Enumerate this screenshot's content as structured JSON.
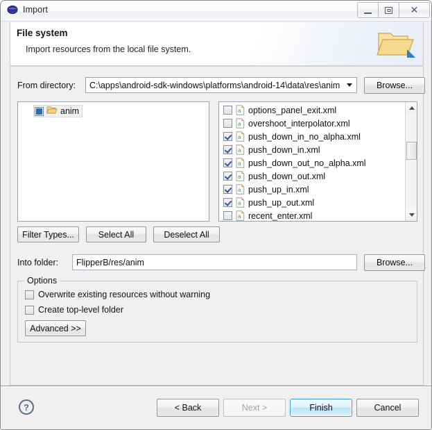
{
  "window": {
    "title": "Import",
    "app_icon": "eclipse-sphere-icon",
    "controls": {
      "minimize": "minimize-icon",
      "maximize": "maximize-icon",
      "close": "close-icon"
    }
  },
  "header": {
    "title": "File system",
    "description": "Import resources from the local file system.",
    "icon": "open-folder-icon"
  },
  "from_directory": {
    "label": "From directory:",
    "value": "C:\\apps\\android-sdk-windows\\platforms\\android-14\\data\\res\\anim",
    "placeholder": "",
    "browse_label": "Browse..."
  },
  "tree_pane": {
    "items": [
      {
        "label": "anim",
        "icon": "folder-icon",
        "checkbox": "grayed",
        "selected": true
      }
    ]
  },
  "file_pane": {
    "files": [
      {
        "name": "options_panel_exit.xml",
        "checked": false,
        "icon": "android-xml-icon"
      },
      {
        "name": "overshoot_interpolator.xml",
        "checked": false,
        "icon": "android-xml-icon"
      },
      {
        "name": "push_down_in_no_alpha.xml",
        "checked": true,
        "icon": "android-xml-icon"
      },
      {
        "name": "push_down_in.xml",
        "checked": true,
        "icon": "android-xml-icon"
      },
      {
        "name": "push_down_out_no_alpha.xml",
        "checked": true,
        "icon": "android-xml-icon"
      },
      {
        "name": "push_down_out.xml",
        "checked": true,
        "icon": "android-xml-icon"
      },
      {
        "name": "push_up_in.xml",
        "checked": true,
        "icon": "android-xml-icon"
      },
      {
        "name": "push_up_out.xml",
        "checked": true,
        "icon": "android-xml-icon"
      },
      {
        "name": "recent_enter.xml",
        "checked": false,
        "icon": "android-xml-icon"
      }
    ],
    "scrollbar": {
      "up": "scroll-up-icon",
      "down": "scroll-down-icon"
    }
  },
  "selection_buttons": {
    "filter_types": "Filter Types...",
    "select_all": "Select All",
    "deselect_all": "Deselect All"
  },
  "into_folder": {
    "label": "Into folder:",
    "value": "FlipperB/res/anim",
    "placeholder": "",
    "browse_label": "Browse..."
  },
  "options": {
    "group_title": "Options",
    "overwrite": {
      "label": "Overwrite existing resources without warning",
      "checked": false
    },
    "create_top_level": {
      "label": "Create top-level folder",
      "checked": false
    },
    "advanced_label": "Advanced >>"
  },
  "footer": {
    "help": "?",
    "back": "< Back",
    "next": "Next >",
    "finish": "Finish",
    "cancel": "Cancel",
    "next_disabled": true,
    "finish_is_default": true
  },
  "colors": {
    "accent": "#3c9bd6",
    "check": "#2e5c9a",
    "dialog_bg": "#f0f0f0",
    "folder": "#f0c96a"
  }
}
